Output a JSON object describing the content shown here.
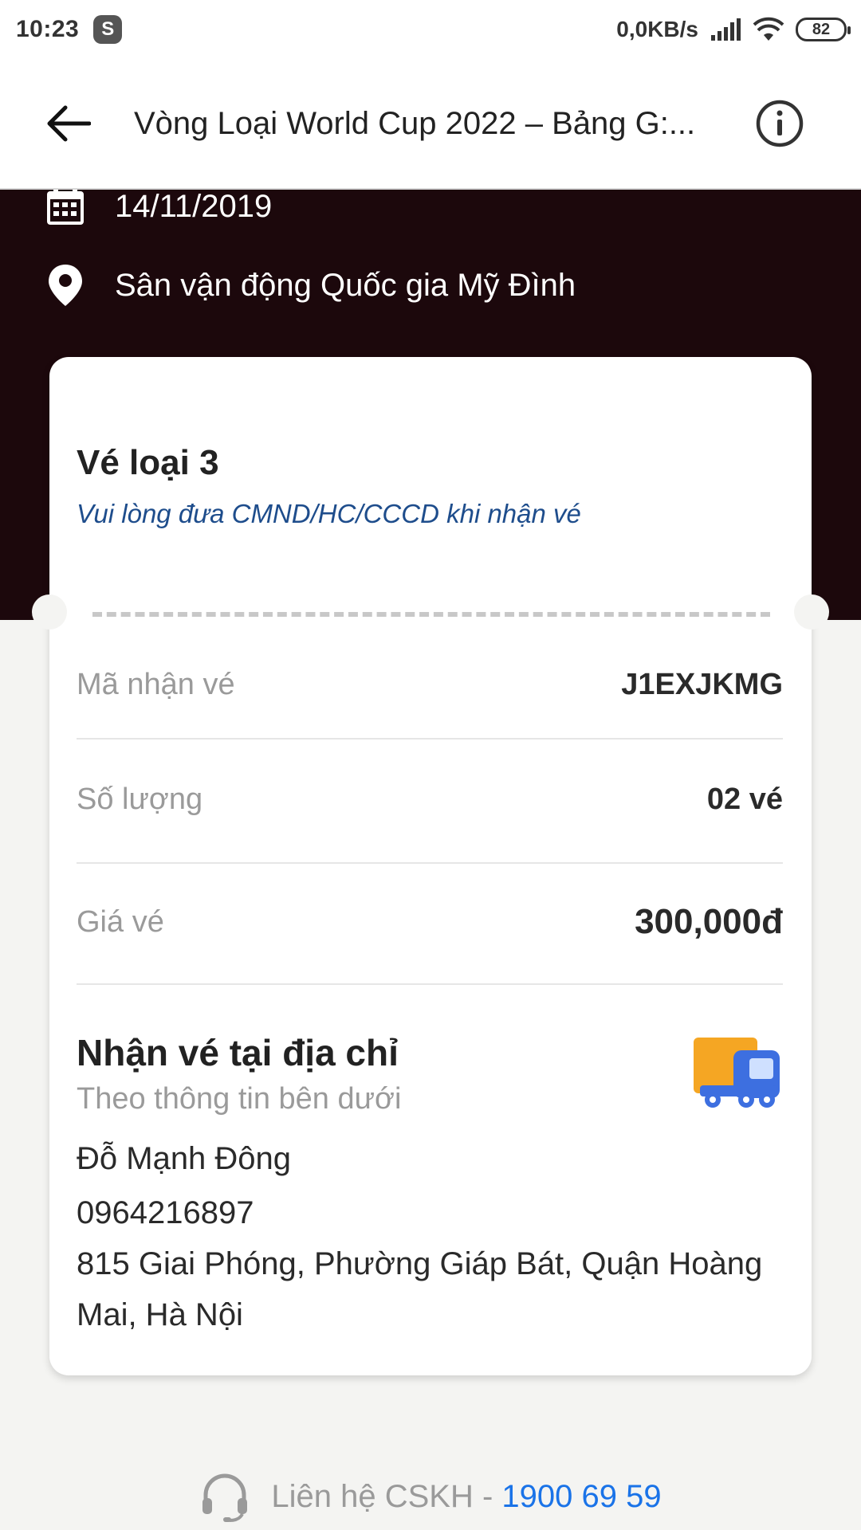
{
  "status_bar": {
    "time": "10:23",
    "app_badge": "S",
    "net_speed": "0,0KB/s",
    "battery": "82"
  },
  "app_bar": {
    "title": "Vòng Loại World Cup 2022 – Bảng G:..."
  },
  "event": {
    "date": "14/11/2019",
    "venue": "Sân vận động Quốc gia Mỹ Đình"
  },
  "ticket": {
    "type": "Vé loại 3",
    "note": "Vui lòng đưa CMND/HC/CCCD khi nhận vé",
    "rows": [
      {
        "label": "Mã nhận vé",
        "value": "J1EXJKMG"
      },
      {
        "label": "Số lượng",
        "value": "02 vé"
      },
      {
        "label": "Giá vé",
        "value": "300,000đ"
      }
    ],
    "delivery": {
      "title": "Nhận vé tại địa chỉ",
      "subtitle": "Theo thông tin bên dưới",
      "name": "Đỗ Mạnh Đông",
      "phone": "0964216897",
      "address": "815 Giai Phóng, Phường Giáp Bát, Quận Hoàng Mai, Hà Nội"
    }
  },
  "contact": {
    "label": "Liên hệ CSKH - ",
    "phone": "1900 69 59"
  },
  "colors": {
    "hero_bg": "#1c080c",
    "note_blue": "#1e4d8c",
    "link_blue": "#1a73e8",
    "truck_orange": "#f5a623",
    "truck_blue": "#3d6fe0"
  },
  "icons": [
    "back-arrow-icon",
    "info-icon",
    "calendar-icon",
    "location-pin-icon",
    "delivery-truck-icon",
    "headset-icon",
    "signal-icon",
    "wifi-icon"
  ]
}
